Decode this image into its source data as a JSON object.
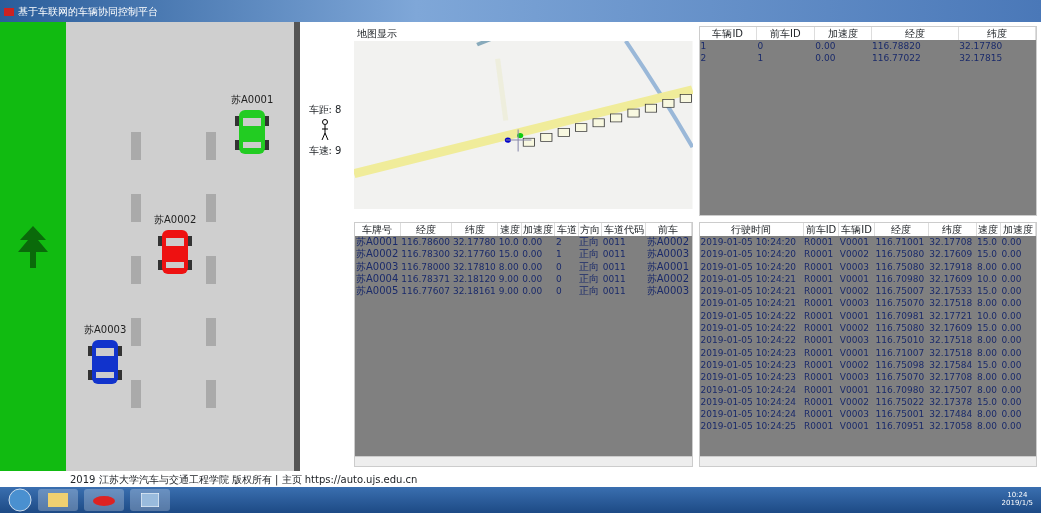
{
  "window": {
    "title": "基于车联网的车辆协同控制平台"
  },
  "road": {
    "cars": [
      {
        "label": "苏A0001",
        "color": "#22cc22"
      },
      {
        "label": "苏A0002",
        "color": "#ee1111"
      },
      {
        "label": "苏A0003",
        "color": "#1133cc"
      }
    ]
  },
  "legend": {
    "top": "车距: 8",
    "bottom": "车速: 9"
  },
  "map": {
    "title": "地图显示"
  },
  "vehicle_table": {
    "columns": [
      "车辆ID",
      "前车ID",
      "加速度",
      "经度",
      "纬度"
    ],
    "rows": [
      [
        "1",
        "0",
        "0.00",
        "116.78820",
        "32.17780"
      ],
      [
        "2",
        "1",
        "0.00",
        "116.77022",
        "32.17815"
      ]
    ]
  },
  "track_table": {
    "columns": [
      "车牌号",
      "经度",
      "纬度",
      "速度",
      "加速度",
      "车道",
      "方向",
      "车道代码",
      "前车"
    ],
    "rows": [
      [
        "苏A0001",
        "116.78600",
        "32.17780",
        "10.0",
        "0.00",
        "2",
        "正向",
        "0011",
        "苏A0002"
      ],
      [
        "苏A0002",
        "116.78300",
        "32.17760",
        "15.0",
        "0.00",
        "1",
        "正向",
        "0011",
        "苏A0003"
      ],
      [
        "苏A0003",
        "116.78000",
        "32.17810",
        "8.00",
        "0.00",
        "0",
        "正向",
        "0011",
        "苏A0001"
      ],
      [
        "苏A0004",
        "116.78371",
        "32.18120",
        "9.00",
        "0.00",
        "0",
        "正向",
        "0011",
        "苏A0002"
      ],
      [
        "苏A0005",
        "116.77607",
        "32.18161",
        "9.00",
        "0.00",
        "0",
        "正向",
        "0011",
        "苏A0003"
      ]
    ]
  },
  "log_table": {
    "columns": [
      "行驶时间",
      "前车ID",
      "车辆ID",
      "经度",
      "纬度",
      "速度",
      "加速度"
    ],
    "rows": [
      [
        "2019-01-05 10:24:20",
        "R0001",
        "V0001",
        "116.71001",
        "32.17708",
        "15.0",
        "0.00"
      ],
      [
        "2019-01-05 10:24:20",
        "R0001",
        "V0002",
        "116.75080",
        "32.17609",
        "15.0",
        "0.00"
      ],
      [
        "2019-01-05 10:24:20",
        "R0001",
        "V0003",
        "116.75080",
        "32.17918",
        "8.00",
        "0.00"
      ],
      [
        "2019-01-05 10:24:21",
        "R0001",
        "V0001",
        "116.70980",
        "32.17609",
        "10.0",
        "0.00"
      ],
      [
        "2019-01-05 10:24:21",
        "R0001",
        "V0002",
        "116.75007",
        "32.17533",
        "15.0",
        "0.00"
      ],
      [
        "2019-01-05 10:24:21",
        "R0001",
        "V0003",
        "116.75070",
        "32.17518",
        "8.00",
        "0.00"
      ],
      [
        "2019-01-05 10:24:22",
        "R0001",
        "V0001",
        "116.70981",
        "32.17721",
        "10.0",
        "0.00"
      ],
      [
        "2019-01-05 10:24:22",
        "R0001",
        "V0002",
        "116.75080",
        "32.17609",
        "15.0",
        "0.00"
      ],
      [
        "2019-01-05 10:24:22",
        "R0001",
        "V0003",
        "116.75010",
        "32.17518",
        "8.00",
        "0.00"
      ],
      [
        "2019-01-05 10:24:23",
        "R0001",
        "V0001",
        "116.71007",
        "32.17518",
        "8.00",
        "0.00"
      ],
      [
        "2019-01-05 10:24:23",
        "R0001",
        "V0002",
        "116.75098",
        "32.17584",
        "15.0",
        "0.00"
      ],
      [
        "2019-01-05 10:24:23",
        "R0001",
        "V0003",
        "116.75070",
        "32.17708",
        "8.00",
        "0.00"
      ],
      [
        "2019-01-05 10:24:24",
        "R0001",
        "V0001",
        "116.70980",
        "32.17507",
        "8.00",
        "0.00"
      ],
      [
        "2019-01-05 10:24:24",
        "R0001",
        "V0002",
        "116.75022",
        "32.17378",
        "15.0",
        "0.00"
      ],
      [
        "2019-01-05 10:24:24",
        "R0001",
        "V0003",
        "116.75001",
        "32.17484",
        "8.00",
        "0.00"
      ],
      [
        "2019-01-05 10:24:25",
        "R0001",
        "V0001",
        "116.70951",
        "32.17058",
        "8.00",
        "0.00"
      ]
    ]
  },
  "status_bar": {
    "text": "2019 江苏大学汽车与交通工程学院 版权所有 | 主页 https://auto.ujs.edu.cn"
  },
  "taskbar": {
    "time": "10:24",
    "date": "2019/1/5"
  }
}
